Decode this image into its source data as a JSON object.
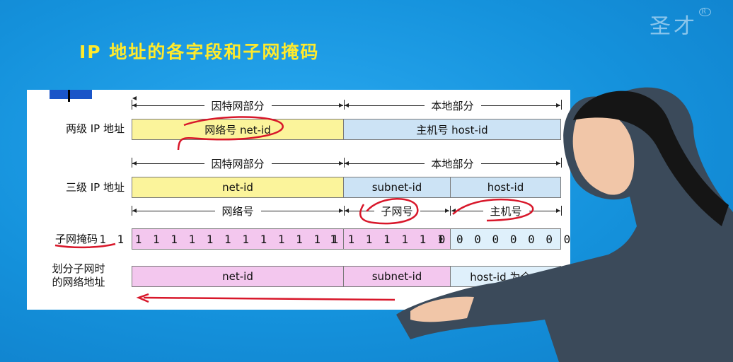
{
  "logo": {
    "text": "圣才",
    "mark": "R"
  },
  "title": "IP 地址的各字段和子网掩码",
  "rows": {
    "two_level": {
      "label": "两级 IP 地址",
      "span_internet": "因特网部分",
      "span_local": "本地部分",
      "cell_net": "网络号 net-id",
      "cell_host": "主机号 host-id"
    },
    "three_level": {
      "label": "三级 IP 地址",
      "span_internet": "因特网部分",
      "span_local": "本地部分",
      "cell_net": "net-id",
      "cell_subnet": "subnet-id",
      "cell_host": "host-id",
      "sub_net": "网络号",
      "sub_subnet": "子网号",
      "sub_host": "主机号"
    },
    "mask": {
      "label": "子网掩码",
      "net_bits": "1 1 1 1 1 1 1 1 1 1 1 1 1 1 1 1",
      "subnet_bits": "1 1 1 1 1 1 1 1",
      "host_bits": "0 0 0 0 0 0 0 0"
    },
    "subnet_addr": {
      "label_line1": "划分子网时",
      "label_line2": "的网络地址",
      "cell_net": "net-id",
      "cell_subnet": "subnet-id",
      "cell_host": "host-id 为全 0"
    }
  },
  "colors": {
    "background": "#1592dc",
    "title": "#ffea2c",
    "yellow_cell": "#fbf49b",
    "blue_cell": "#cce3f5",
    "pink_cell": "#f3c7ee",
    "annotation_ink": "#d8172a"
  }
}
